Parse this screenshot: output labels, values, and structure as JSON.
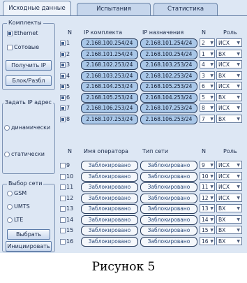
{
  "tabs": [
    "Исходные данные",
    "Испытания",
    "Статистика"
  ],
  "komplekty": {
    "title": "Комплекты",
    "ethernet": "Ethernet",
    "cellular": "Сотовые",
    "get_ip": "Получить IP",
    "block": "Блок/Разбл"
  },
  "ip_setup": {
    "title": "Задать IP адрес",
    "dynamic": "динамически",
    "static": "статически"
  },
  "network": {
    "title": "Выбор сети",
    "options": [
      "GSM",
      "UMTS",
      "LTE"
    ],
    "select_btn": "Выбрать",
    "init_btn": "Инициировать"
  },
  "ip_table": {
    "headers": {
      "n": "N",
      "src": "IP комплекта",
      "dst": "IP назначения",
      "n2": "N",
      "role": "Роль"
    },
    "rows": [
      {
        "n": "1",
        "src": "2.168.100.254/24",
        "dst": "2.168.101.254/24",
        "n2": "2",
        "role": "ИСХ",
        "checked": true
      },
      {
        "n": "2",
        "src": "2.168.101.254/24",
        "dst": "2.168.100.254/24",
        "n2": "1",
        "role": "ВХ",
        "checked": true
      },
      {
        "n": "3",
        "src": "2.168.102.253/24",
        "dst": "2.168.103.253/24",
        "n2": "4",
        "role": "ИСХ",
        "checked": true
      },
      {
        "n": "4",
        "src": "2.168.103.253/24",
        "dst": "2.168.102.253/24",
        "n2": "3",
        "role": "ВХ",
        "checked": true
      },
      {
        "n": "5",
        "src": "2.168.104.253/24",
        "dst": "2.168.105.253/24",
        "n2": "6",
        "role": "ИСХ",
        "checked": true
      },
      {
        "n": "6",
        "src": "2.168.105.253/24",
        "dst": "2.168.104.253/24",
        "n2": "5",
        "role": "ВХ",
        "checked": true
      },
      {
        "n": "7",
        "src": "2.168.106.253/24",
        "dst": "2.168.107.253/24",
        "n2": "8",
        "role": "ИСХ",
        "checked": true
      },
      {
        "n": "8",
        "src": "2.168.107.253/24",
        "dst": "2.168.106.253/24",
        "n2": "7",
        "role": "ВХ",
        "checked": true
      }
    ]
  },
  "op_table": {
    "headers": {
      "n": "N",
      "op": "Имя оператора",
      "net": "Тип сети",
      "n2": "N",
      "role": "Роль"
    },
    "rows": [
      {
        "n": "9",
        "op": "Заблокировано",
        "net": "Заблокировано",
        "n2": "9",
        "role": "ИСХ"
      },
      {
        "n": "10",
        "op": "Заблокировано",
        "net": "Заблокировано",
        "n2": "10",
        "role": "ИСХ"
      },
      {
        "n": "11",
        "op": "Заблокировано",
        "net": "Заблокировано",
        "n2": "11",
        "role": "ИСХ"
      },
      {
        "n": "12",
        "op": "Заблокировано",
        "net": "Заблокировано",
        "n2": "12",
        "role": "ИСХ"
      },
      {
        "n": "13",
        "op": "Заблокировано",
        "net": "Заблокировано",
        "n2": "13",
        "role": "ВХ"
      },
      {
        "n": "14",
        "op": "Заблокировано",
        "net": "Заблокировано",
        "n2": "14",
        "role": "ВХ"
      },
      {
        "n": "15",
        "op": "Заблокировано",
        "net": "Заблокировано",
        "n2": "15",
        "role": "ВХ"
      },
      {
        "n": "16",
        "op": "Заблокировано",
        "net": "Заблокировано",
        "n2": "16",
        "role": "ВХ"
      }
    ]
  },
  "caption": "Рисунок 5"
}
